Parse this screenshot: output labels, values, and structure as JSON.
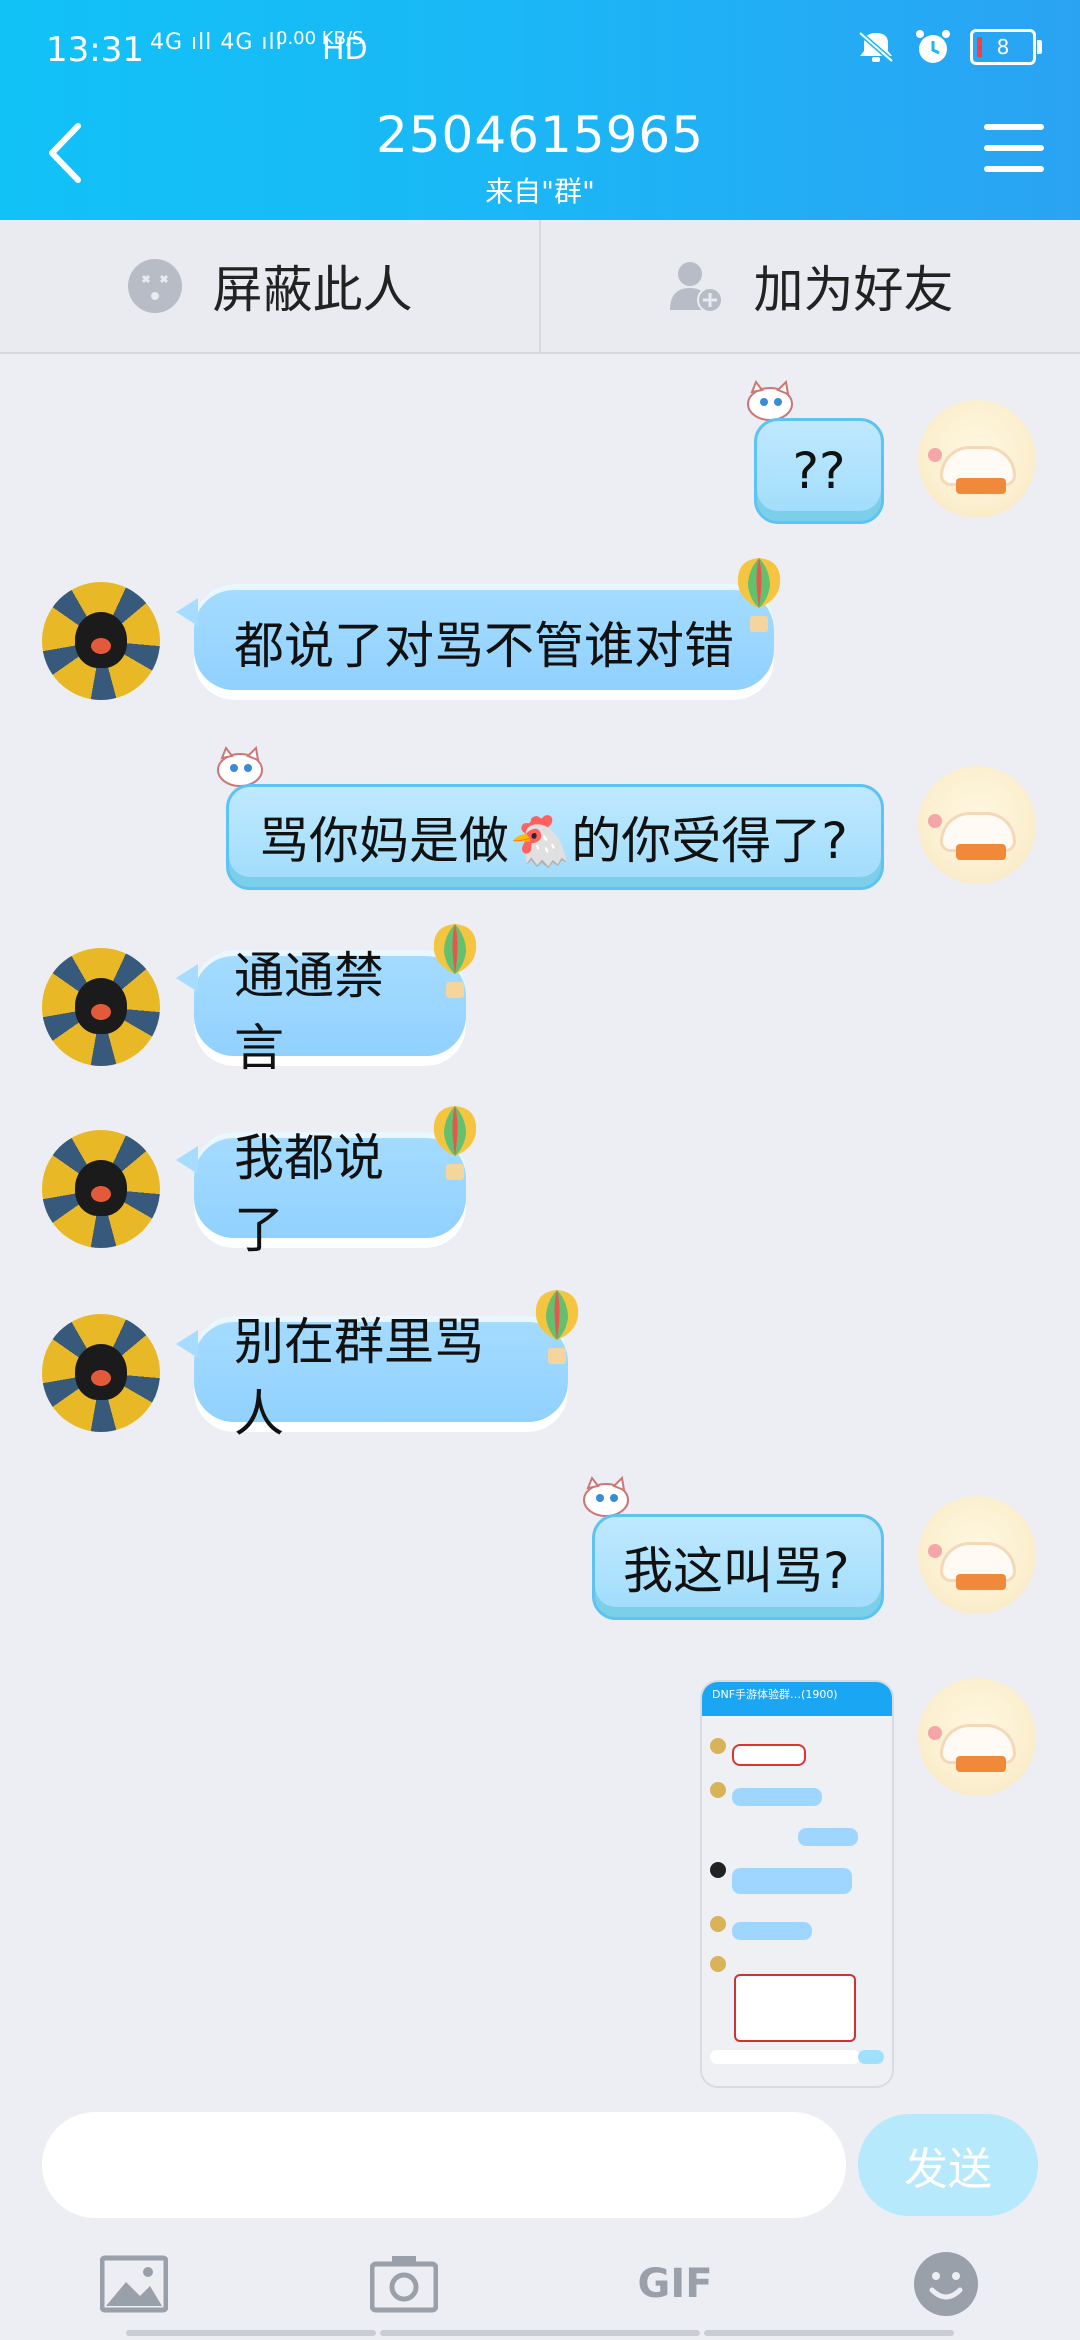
{
  "status_bar": {
    "time": "13:31",
    "network": "4G ıll 4G ıll",
    "speed": "0.00 KB/S",
    "hd": "HD",
    "battery": "8"
  },
  "header": {
    "title": "2504615965",
    "subtitle": "来自\"群\""
  },
  "actions": {
    "block_label": "屏蔽此人",
    "add_friend_label": "加为好友"
  },
  "messages": [
    {
      "side": "right",
      "text": "??"
    },
    {
      "side": "left",
      "text": "都说了对骂不管谁对错"
    },
    {
      "side": "right",
      "text": "骂你妈是做🐔的你受得了?"
    },
    {
      "side": "left",
      "text": "通通禁言"
    },
    {
      "side": "left",
      "text": "我都说了"
    },
    {
      "side": "left",
      "text": "别在群里骂人"
    },
    {
      "side": "right",
      "text": "我这叫骂?"
    }
  ],
  "screenshot_thumb": {
    "header": "DNF手游体验群…(1900)"
  },
  "input": {
    "placeholder": "",
    "send_label": "发送"
  },
  "toolbar": {
    "gif_label": "GIF"
  },
  "colors": {
    "header_start": "#11c2f7",
    "header_end": "#2aa3f3",
    "bubble": "#a5dcff",
    "send_disabled": "#b5e9fb",
    "background": "#eceef3"
  },
  "icons": [
    "back-arrow-icon",
    "menu-icon",
    "block-face-icon",
    "add-friend-icon",
    "image-icon",
    "camera-icon",
    "gif-icon",
    "emoji-icon"
  ]
}
